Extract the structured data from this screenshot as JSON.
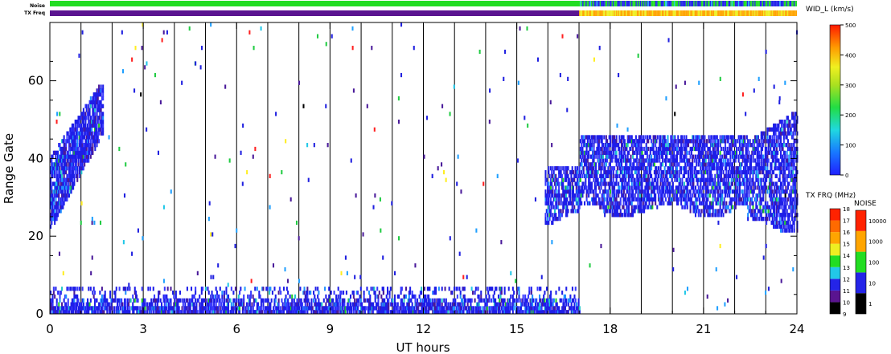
{
  "chart_data": {
    "type": "heatmap",
    "xlabel": "UT hours",
    "ylabel": "Range Gate",
    "xlim": [
      0,
      24
    ],
    "ylim": [
      0,
      75
    ],
    "xticks": [
      0,
      3,
      6,
      9,
      12,
      15,
      18,
      21,
      24
    ],
    "yticks": [
      0,
      20,
      40,
      60
    ],
    "hour_grid": true,
    "status_bars": {
      "noise_label": "Noise",
      "txfreq_label": "TX Freq",
      "noise_segments": [
        {
          "from": 0,
          "to": 17,
          "color": "#22dd22"
        },
        {
          "from": 17,
          "to": 24,
          "color": "mixed-blue-green"
        }
      ],
      "txfreq_segments": [
        {
          "from": 0,
          "to": 17,
          "color": "#5a1490"
        },
        {
          "from": 17,
          "to": 24,
          "color": "mixed-orange-yellow"
        }
      ]
    },
    "colorbars": {
      "width": {
        "title": "WID_L (km/s)",
        "min": 0,
        "max": 500,
        "ticks": [
          "0",
          "100",
          "200",
          "300",
          "400",
          "500"
        ]
      },
      "tx_freq": {
        "title": "TX FRQ (MHz)",
        "ticks": [
          "9",
          "10",
          "11",
          "12",
          "13",
          "14",
          "15",
          "16",
          "17",
          "18"
        ],
        "colors": [
          "#000000",
          "#5a1490",
          "#2424e8",
          "#22c8e8",
          "#22dd22",
          "#eeee22",
          "#ffa500",
          "#ff6a00",
          "#ff2200"
        ]
      },
      "noise": {
        "title": "NOISE",
        "ticks": [
          "1",
          "10",
          "100",
          "1000",
          "10000"
        ],
        "colors": [
          "#000000",
          "#2424e8",
          "#22dd22",
          "#ffa500",
          "#ff2200"
        ]
      }
    },
    "echo_regions": [
      {
        "name": "low-gate-echoes",
        "x": [
          0,
          17
        ],
        "y": [
          0,
          7
        ],
        "density": "high",
        "dominant": "blue"
      },
      {
        "name": "morning-band",
        "x": [
          0,
          1.7
        ],
        "y": [
          22,
          61
        ],
        "density": "high",
        "dominant": "blue"
      },
      {
        "name": "evening-band",
        "x": [
          15.9,
          24
        ],
        "y": [
          22,
          48
        ],
        "density": "high",
        "dominant": "blue"
      },
      {
        "name": "scattered",
        "x": [
          0,
          24
        ],
        "y": [
          0,
          75
        ],
        "density": "sparse",
        "dominant": "mixed"
      }
    ]
  }
}
